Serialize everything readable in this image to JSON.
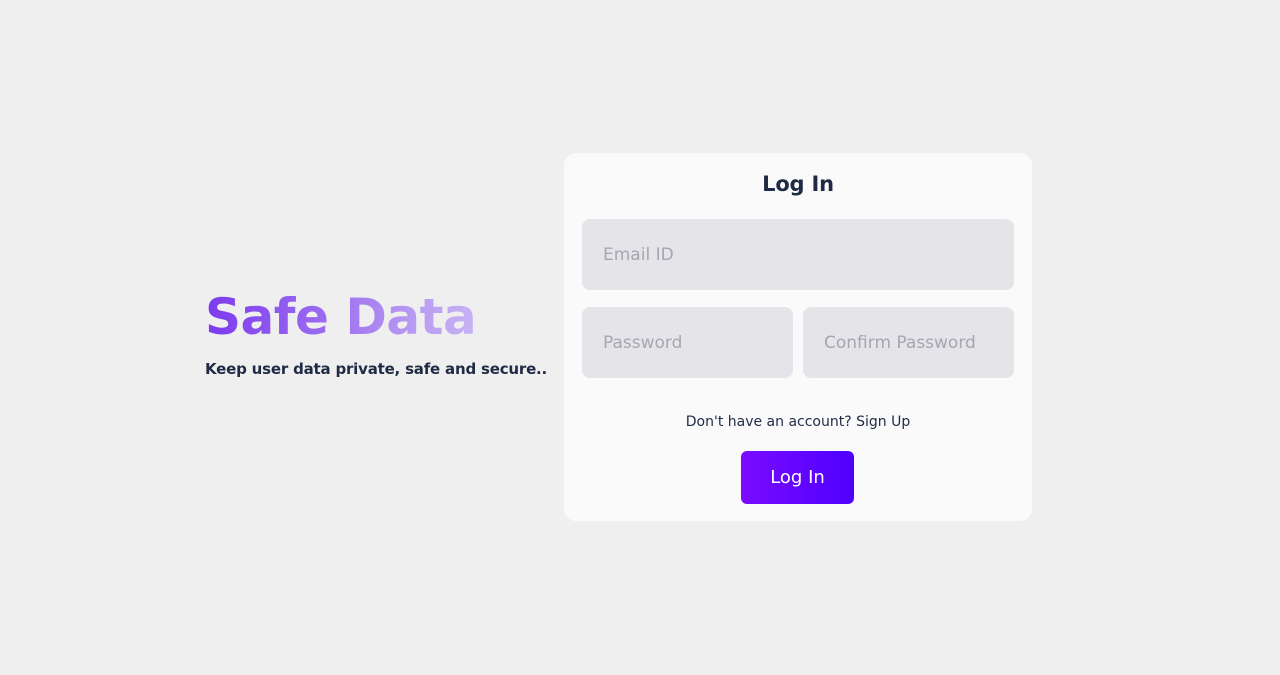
{
  "brand": {
    "title": "Safe Data",
    "tagline": "Keep user data private, safe and secure.."
  },
  "login_form": {
    "heading": "Log In",
    "email_placeholder": "Email ID",
    "password_placeholder": "Password",
    "confirm_password_placeholder": "Confirm Password",
    "signup_prompt": "Don't have an account?",
    "signup_link": "Sign Up",
    "submit_label": "Log In"
  },
  "colors": {
    "background": "#efefef",
    "card": "#fafafa",
    "input": "#e4e4e9",
    "text_dark": "#1f2a44",
    "brand_purple": "#7c3aed",
    "button_gradient_start": "#7a0bff",
    "button_gradient_end": "#4f00ff"
  }
}
